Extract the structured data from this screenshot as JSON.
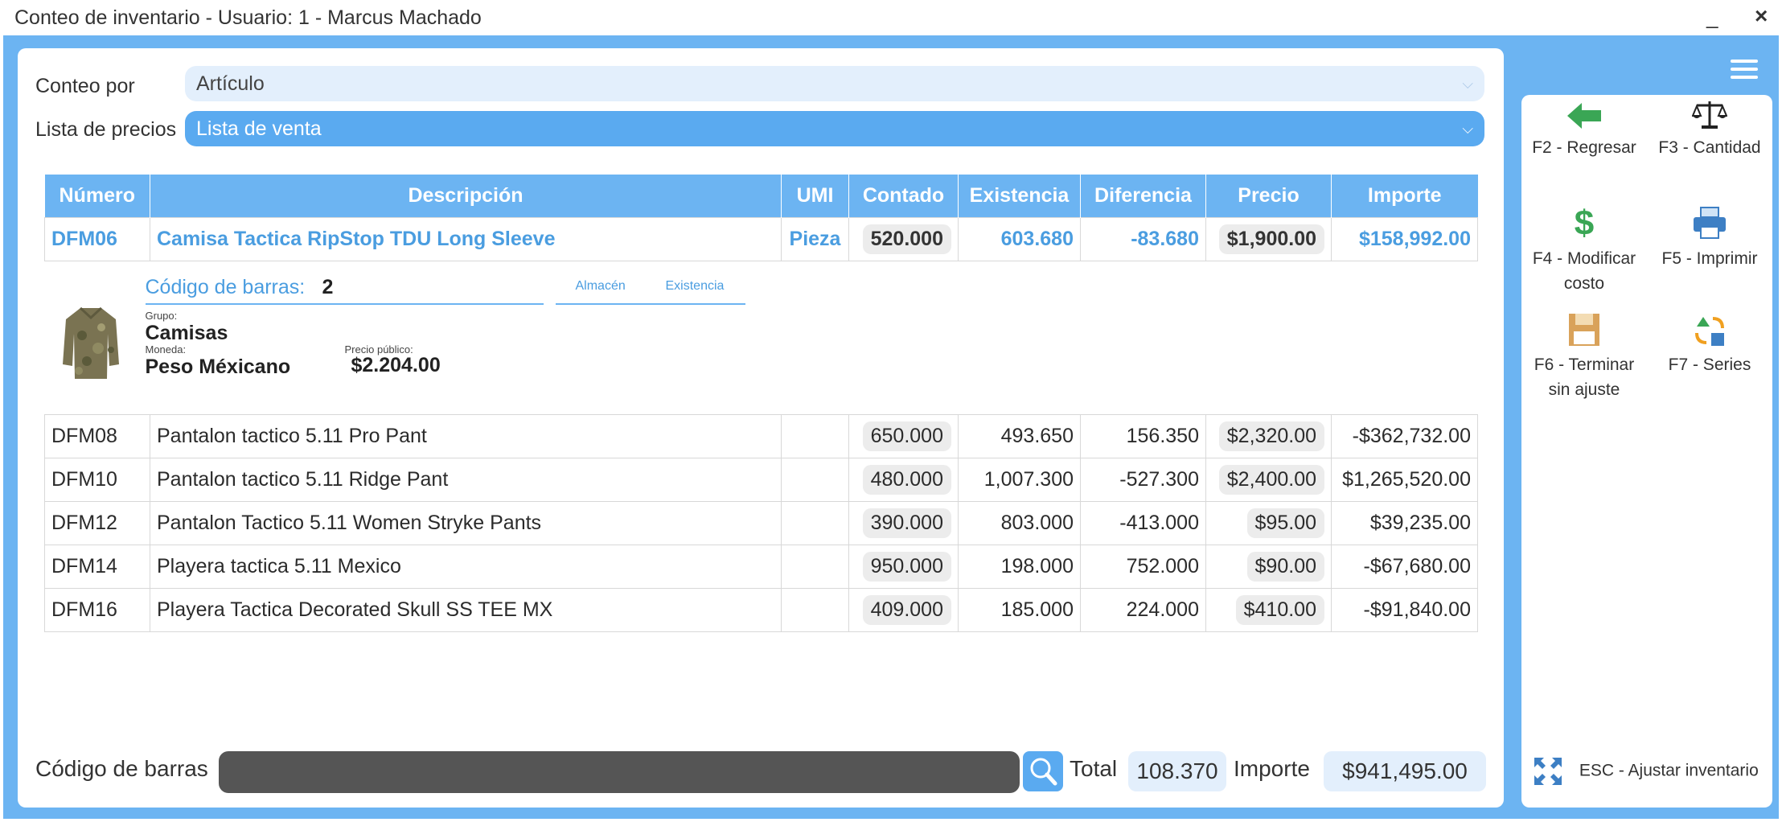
{
  "window": {
    "title": "Conteo de inventario - Usuario: 1 - Marcus  Machado",
    "minimize": "_",
    "close": "×"
  },
  "form": {
    "conteo_label": "Conteo por",
    "conteo_value": "Artículo",
    "lista_label": "Lista de precios",
    "lista_value": "Lista de venta"
  },
  "table": {
    "headers": [
      "Número",
      "Descripción",
      "UMI",
      "Contado",
      "Existencia",
      "Diferencia",
      "Precio",
      "Importe"
    ],
    "selected": {
      "numero": "DFM06",
      "descripcion": "Camisa Tactica RipStop TDU Long Sleeve",
      "umi": "Pieza",
      "contado": "520.000",
      "existencia": "603.680",
      "diferencia": "-83.680",
      "precio": "$1,900.00",
      "importe": "$158,992.00"
    },
    "detail": {
      "barcode_label": "Código de barras:",
      "barcode_value": "2",
      "tab_almacen": "Almacén",
      "tab_existencia": "Existencia",
      "grupo_label": "Grupo:",
      "grupo_value": "Camisas",
      "moneda_label": "Moneda:",
      "moneda_value": "Peso Méxicano",
      "precio_publico_label": "Precio público:",
      "precio_publico_value": "$2.204.00"
    },
    "rows": [
      {
        "numero": "DFM08",
        "descripcion": "Pantalon tactico 5.11 Pro Pant",
        "umi": "",
        "contado": "650.000",
        "existencia": "493.650",
        "diferencia": "156.350",
        "precio": "$2,320.00",
        "importe": "-$362,732.00"
      },
      {
        "numero": "DFM10",
        "descripcion": "Pantalon tactico 5.11 Ridge Pant",
        "umi": "",
        "contado": "480.000",
        "existencia": "1,007.300",
        "diferencia": "-527.300",
        "precio": "$2,400.00",
        "importe": "$1,265,520.00"
      },
      {
        "numero": "DFM12",
        "descripcion": "Pantalon Tactico 5.11 Women Stryke Pants",
        "umi": "",
        "contado": "390.000",
        "existencia": "803.000",
        "diferencia": "-413.000",
        "precio": "$95.00",
        "importe": "$39,235.00"
      },
      {
        "numero": "DFM14",
        "descripcion": "Playera tactica 5.11 Mexico",
        "umi": "",
        "contado": "950.000",
        "existencia": "198.000",
        "diferencia": "752.000",
        "precio": "$90.00",
        "importe": "-$67,680.00"
      },
      {
        "numero": "DFM16",
        "descripcion": "Playera Tactica Decorated Skull SS TEE MX",
        "umi": "",
        "contado": "409.000",
        "existencia": "185.000",
        "diferencia": "224.000",
        "precio": "$410.00",
        "importe": "-$91,840.00"
      }
    ]
  },
  "footer": {
    "barcode_label": "Código de barras",
    "total_label": "Total",
    "total_value": "108.370",
    "importe_label": "Importe",
    "importe_value": "$941,495.00"
  },
  "actions": {
    "f2": "F2 - Regresar",
    "f3": "F3 - Cantidad",
    "f4_line1": "F4 - Modificar",
    "f4_line2": "costo",
    "f5": "F5 - Imprimir",
    "f6_line1": "F6 - Terminar",
    "f6_line2": "sin ajuste",
    "f7": "F7 - Series",
    "esc": "ESC - Ajustar inventario"
  },
  "colors": {
    "accent": "#6cb4f2",
    "accent_text": "#4a9de0",
    "green": "#3aa655"
  },
  "icons": [
    "back-arrow-icon",
    "scale-icon",
    "dollar-icon",
    "printer-icon",
    "save-icon",
    "series-icon",
    "expand-icon",
    "search-icon",
    "menu-icon"
  ]
}
